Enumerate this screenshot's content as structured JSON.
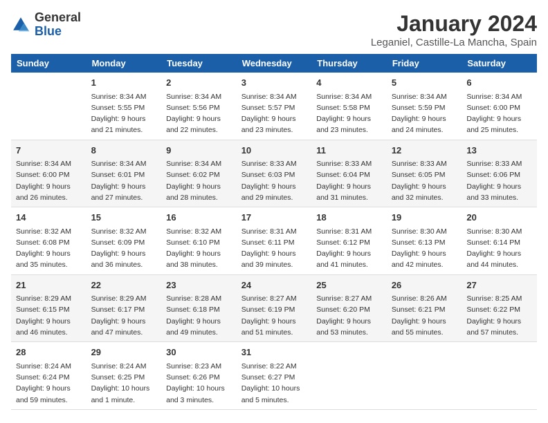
{
  "logo": {
    "general": "General",
    "blue": "Blue"
  },
  "title": "January 2024",
  "location": "Leganiel, Castille-La Mancha, Spain",
  "days_of_week": [
    "Sunday",
    "Monday",
    "Tuesday",
    "Wednesday",
    "Thursday",
    "Friday",
    "Saturday"
  ],
  "weeks": [
    [
      {
        "num": "",
        "sunrise": "",
        "sunset": "",
        "daylight": ""
      },
      {
        "num": "1",
        "sunrise": "Sunrise: 8:34 AM",
        "sunset": "Sunset: 5:55 PM",
        "daylight": "Daylight: 9 hours and 21 minutes."
      },
      {
        "num": "2",
        "sunrise": "Sunrise: 8:34 AM",
        "sunset": "Sunset: 5:56 PM",
        "daylight": "Daylight: 9 hours and 22 minutes."
      },
      {
        "num": "3",
        "sunrise": "Sunrise: 8:34 AM",
        "sunset": "Sunset: 5:57 PM",
        "daylight": "Daylight: 9 hours and 23 minutes."
      },
      {
        "num": "4",
        "sunrise": "Sunrise: 8:34 AM",
        "sunset": "Sunset: 5:58 PM",
        "daylight": "Daylight: 9 hours and 23 minutes."
      },
      {
        "num": "5",
        "sunrise": "Sunrise: 8:34 AM",
        "sunset": "Sunset: 5:59 PM",
        "daylight": "Daylight: 9 hours and 24 minutes."
      },
      {
        "num": "6",
        "sunrise": "Sunrise: 8:34 AM",
        "sunset": "Sunset: 6:00 PM",
        "daylight": "Daylight: 9 hours and 25 minutes."
      }
    ],
    [
      {
        "num": "7",
        "sunrise": "Sunrise: 8:34 AM",
        "sunset": "Sunset: 6:00 PM",
        "daylight": "Daylight: 9 hours and 26 minutes."
      },
      {
        "num": "8",
        "sunrise": "Sunrise: 8:34 AM",
        "sunset": "Sunset: 6:01 PM",
        "daylight": "Daylight: 9 hours and 27 minutes."
      },
      {
        "num": "9",
        "sunrise": "Sunrise: 8:34 AM",
        "sunset": "Sunset: 6:02 PM",
        "daylight": "Daylight: 9 hours and 28 minutes."
      },
      {
        "num": "10",
        "sunrise": "Sunrise: 8:33 AM",
        "sunset": "Sunset: 6:03 PM",
        "daylight": "Daylight: 9 hours and 29 minutes."
      },
      {
        "num": "11",
        "sunrise": "Sunrise: 8:33 AM",
        "sunset": "Sunset: 6:04 PM",
        "daylight": "Daylight: 9 hours and 31 minutes."
      },
      {
        "num": "12",
        "sunrise": "Sunrise: 8:33 AM",
        "sunset": "Sunset: 6:05 PM",
        "daylight": "Daylight: 9 hours and 32 minutes."
      },
      {
        "num": "13",
        "sunrise": "Sunrise: 8:33 AM",
        "sunset": "Sunset: 6:06 PM",
        "daylight": "Daylight: 9 hours and 33 minutes."
      }
    ],
    [
      {
        "num": "14",
        "sunrise": "Sunrise: 8:32 AM",
        "sunset": "Sunset: 6:08 PM",
        "daylight": "Daylight: 9 hours and 35 minutes."
      },
      {
        "num": "15",
        "sunrise": "Sunrise: 8:32 AM",
        "sunset": "Sunset: 6:09 PM",
        "daylight": "Daylight: 9 hours and 36 minutes."
      },
      {
        "num": "16",
        "sunrise": "Sunrise: 8:32 AM",
        "sunset": "Sunset: 6:10 PM",
        "daylight": "Daylight: 9 hours and 38 minutes."
      },
      {
        "num": "17",
        "sunrise": "Sunrise: 8:31 AM",
        "sunset": "Sunset: 6:11 PM",
        "daylight": "Daylight: 9 hours and 39 minutes."
      },
      {
        "num": "18",
        "sunrise": "Sunrise: 8:31 AM",
        "sunset": "Sunset: 6:12 PM",
        "daylight": "Daylight: 9 hours and 41 minutes."
      },
      {
        "num": "19",
        "sunrise": "Sunrise: 8:30 AM",
        "sunset": "Sunset: 6:13 PM",
        "daylight": "Daylight: 9 hours and 42 minutes."
      },
      {
        "num": "20",
        "sunrise": "Sunrise: 8:30 AM",
        "sunset": "Sunset: 6:14 PM",
        "daylight": "Daylight: 9 hours and 44 minutes."
      }
    ],
    [
      {
        "num": "21",
        "sunrise": "Sunrise: 8:29 AM",
        "sunset": "Sunset: 6:15 PM",
        "daylight": "Daylight: 9 hours and 46 minutes."
      },
      {
        "num": "22",
        "sunrise": "Sunrise: 8:29 AM",
        "sunset": "Sunset: 6:17 PM",
        "daylight": "Daylight: 9 hours and 47 minutes."
      },
      {
        "num": "23",
        "sunrise": "Sunrise: 8:28 AM",
        "sunset": "Sunset: 6:18 PM",
        "daylight": "Daylight: 9 hours and 49 minutes."
      },
      {
        "num": "24",
        "sunrise": "Sunrise: 8:27 AM",
        "sunset": "Sunset: 6:19 PM",
        "daylight": "Daylight: 9 hours and 51 minutes."
      },
      {
        "num": "25",
        "sunrise": "Sunrise: 8:27 AM",
        "sunset": "Sunset: 6:20 PM",
        "daylight": "Daylight: 9 hours and 53 minutes."
      },
      {
        "num": "26",
        "sunrise": "Sunrise: 8:26 AM",
        "sunset": "Sunset: 6:21 PM",
        "daylight": "Daylight: 9 hours and 55 minutes."
      },
      {
        "num": "27",
        "sunrise": "Sunrise: 8:25 AM",
        "sunset": "Sunset: 6:22 PM",
        "daylight": "Daylight: 9 hours and 57 minutes."
      }
    ],
    [
      {
        "num": "28",
        "sunrise": "Sunrise: 8:24 AM",
        "sunset": "Sunset: 6:24 PM",
        "daylight": "Daylight: 9 hours and 59 minutes."
      },
      {
        "num": "29",
        "sunrise": "Sunrise: 8:24 AM",
        "sunset": "Sunset: 6:25 PM",
        "daylight": "Daylight: 10 hours and 1 minute."
      },
      {
        "num": "30",
        "sunrise": "Sunrise: 8:23 AM",
        "sunset": "Sunset: 6:26 PM",
        "daylight": "Daylight: 10 hours and 3 minutes."
      },
      {
        "num": "31",
        "sunrise": "Sunrise: 8:22 AM",
        "sunset": "Sunset: 6:27 PM",
        "daylight": "Daylight: 10 hours and 5 minutes."
      },
      {
        "num": "",
        "sunrise": "",
        "sunset": "",
        "daylight": ""
      },
      {
        "num": "",
        "sunrise": "",
        "sunset": "",
        "daylight": ""
      },
      {
        "num": "",
        "sunrise": "",
        "sunset": "",
        "daylight": ""
      }
    ]
  ]
}
